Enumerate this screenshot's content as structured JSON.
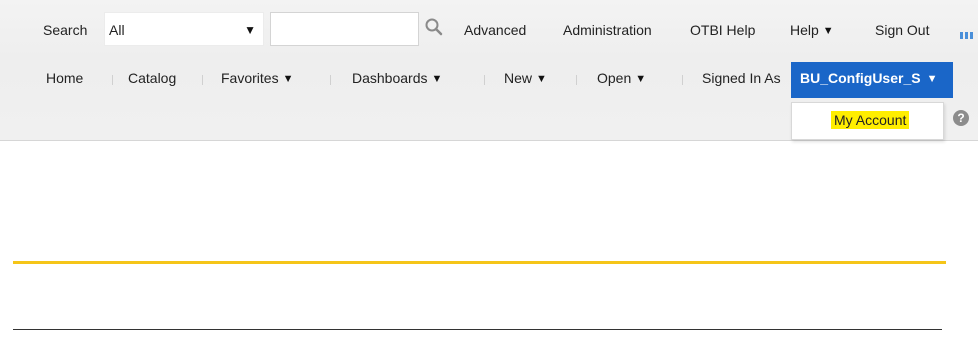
{
  "search": {
    "label": "Search",
    "scope_value": "All",
    "input_value": "",
    "input_placeholder": ""
  },
  "header_links": {
    "advanced": "Advanced",
    "administration": "Administration",
    "otbi_help": "OTBI Help",
    "help": "Help",
    "sign_out": "Sign Out"
  },
  "nav": {
    "home": "Home",
    "catalog": "Catalog",
    "favorites": "Favorites",
    "dashboards": "Dashboards",
    "new": "New",
    "open": "Open",
    "signed_in_as": "Signed In As",
    "user": "BU_ConfigUser_S"
  },
  "user_dropdown": {
    "my_account": "My Account"
  },
  "help_glyph": "?",
  "colors": {
    "accent_blue": "#1a66c8",
    "highlight_yellow": "#ffee00",
    "divider_yellow": "#f5c518"
  },
  "icons": [
    "search-icon",
    "caret-down-icon",
    "more-icon",
    "help-icon"
  ]
}
